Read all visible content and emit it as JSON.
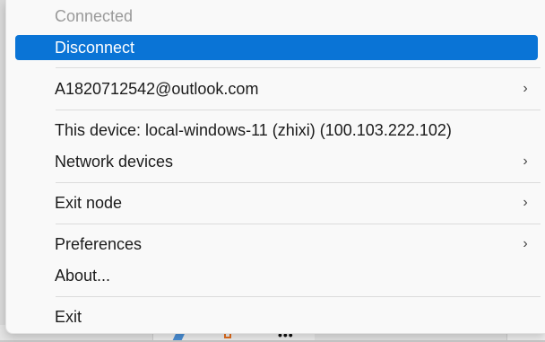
{
  "menu": {
    "status_label": "Connected",
    "disconnect_label": "Disconnect",
    "account_label": "A1820712542@outlook.com",
    "this_device_label": "This device: local-windows-11 (zhixi) (100.103.222.102)",
    "network_devices_label": "Network devices",
    "exit_node_label": "Exit node",
    "preferences_label": "Preferences",
    "about_label": "About...",
    "exit_label": "Exit"
  },
  "colors": {
    "selection": "#0a74d6",
    "menu_background": "#f9f9f9",
    "disabled_text": "#9a9a9a"
  },
  "icons": {
    "submenu": "chevron-right-icon"
  }
}
